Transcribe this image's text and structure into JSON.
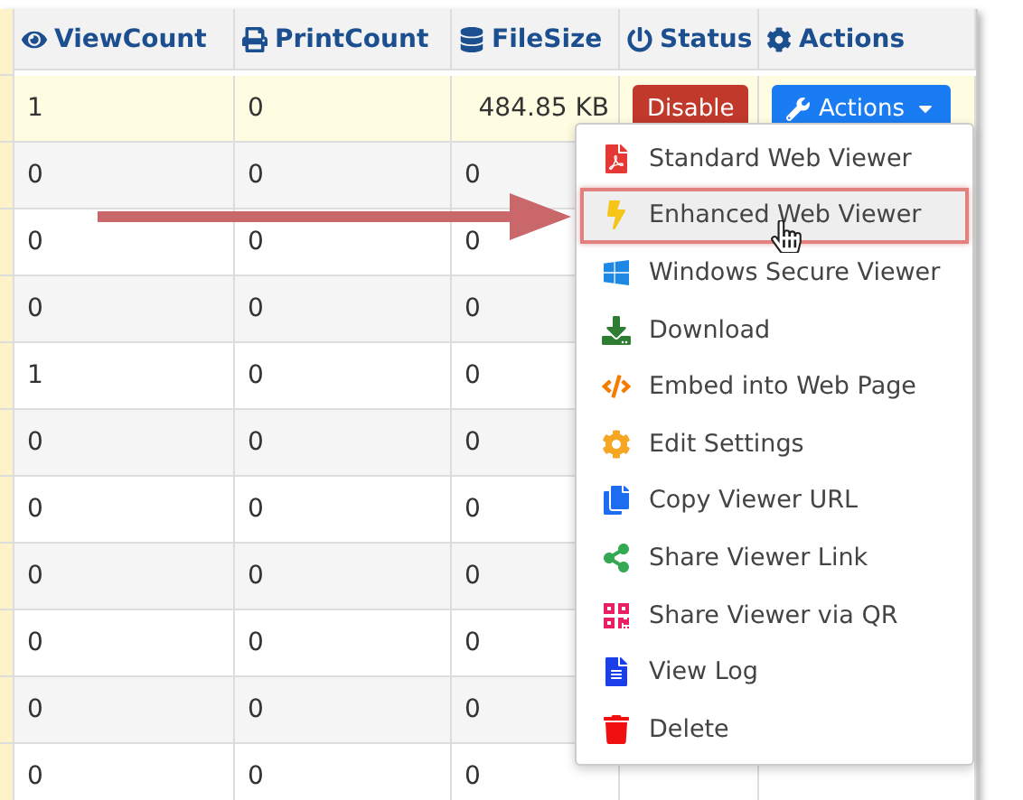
{
  "table": {
    "columns": [
      {
        "label": "ViewCount"
      },
      {
        "label": "PrintCount"
      },
      {
        "label": "FileSize"
      },
      {
        "label": "Status"
      },
      {
        "label": "Actions"
      }
    ],
    "rows": [
      {
        "view_count": "1",
        "print_count": "0",
        "file_size": "484.85 KB",
        "highlighted": true,
        "status_button": "Disable",
        "actions_button": "Actions"
      },
      {
        "view_count": "0",
        "print_count": "0",
        "file_size": "0",
        "highlighted": false
      },
      {
        "view_count": "0",
        "print_count": "0",
        "file_size": "0",
        "highlighted": false
      },
      {
        "view_count": "0",
        "print_count": "0",
        "file_size": "0",
        "highlighted": false
      },
      {
        "view_count": "1",
        "print_count": "0",
        "file_size": "0",
        "highlighted": false
      },
      {
        "view_count": "0",
        "print_count": "0",
        "file_size": "0",
        "highlighted": false
      },
      {
        "view_count": "0",
        "print_count": "0",
        "file_size": "0",
        "highlighted": false
      },
      {
        "view_count": "0",
        "print_count": "0",
        "file_size": "0",
        "highlighted": false
      },
      {
        "view_count": "0",
        "print_count": "0",
        "file_size": "0",
        "highlighted": false
      },
      {
        "view_count": "0",
        "print_count": "0",
        "file_size": "0",
        "highlighted": false
      },
      {
        "view_count": "0",
        "print_count": "0",
        "file_size": "0",
        "highlighted": false
      }
    ]
  },
  "actions_menu": {
    "items": [
      {
        "label": "Standard Web Viewer",
        "selected": false
      },
      {
        "label": "Enhanced Web Viewer",
        "selected": true
      },
      {
        "label": "Windows Secure Viewer",
        "selected": false
      },
      {
        "label": "Download",
        "selected": false
      },
      {
        "label": "Embed into Web Page",
        "selected": false
      },
      {
        "label": "Edit Settings",
        "selected": false
      },
      {
        "label": "Copy Viewer URL",
        "selected": false
      },
      {
        "label": "Share Viewer Link",
        "selected": false
      },
      {
        "label": "Share Viewer via QR",
        "selected": false
      },
      {
        "label": "View Log",
        "selected": false
      },
      {
        "label": "Delete",
        "selected": false
      }
    ]
  }
}
